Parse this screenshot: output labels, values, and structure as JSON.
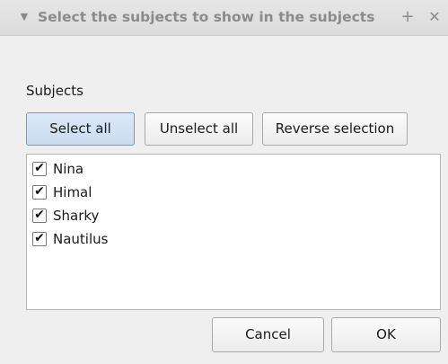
{
  "titlebar": {
    "title": "Select the subjects to show in the subjects",
    "collapse_icon": "▼",
    "plus_icon": "+",
    "close_icon": "✕"
  },
  "subjects": {
    "label": "Subjects",
    "buttons": {
      "select_all": "Select all",
      "unselect_all": "Unselect all",
      "reverse_selection": "Reverse selection"
    },
    "items": [
      {
        "label": "Nina",
        "checked": true,
        "check_glyph": "✔"
      },
      {
        "label": "Himal",
        "checked": true,
        "check_glyph": "✔"
      },
      {
        "label": "Sharky",
        "checked": true,
        "check_glyph": "✔"
      },
      {
        "label": "Nautilus",
        "checked": true,
        "check_glyph": "✔"
      }
    ]
  },
  "footer": {
    "cancel_label": "Cancel",
    "ok_label": "OK"
  }
}
